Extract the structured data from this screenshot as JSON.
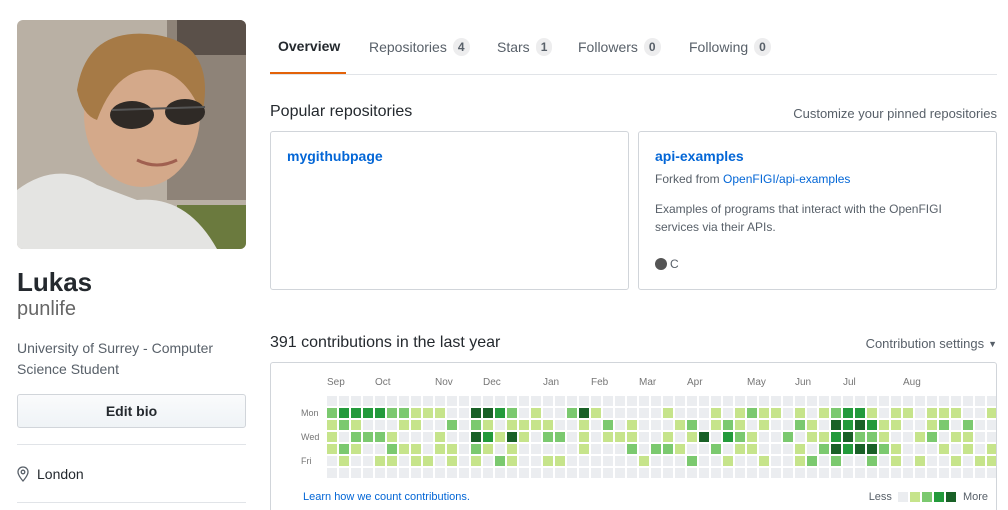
{
  "profile": {
    "name": "Lukas",
    "login": "punlife",
    "bio": "University of Surrey - Computer Science Student",
    "edit_bio_label": "Edit bio",
    "location": "London"
  },
  "tabs": [
    {
      "label": "Overview",
      "count": null
    },
    {
      "label": "Repositories",
      "count": "4"
    },
    {
      "label": "Stars",
      "count": "1"
    },
    {
      "label": "Followers",
      "count": "0"
    },
    {
      "label": "Following",
      "count": "0"
    }
  ],
  "popular": {
    "title": "Popular repositories",
    "customize_label": "Customize your pinned repositories",
    "repos": [
      {
        "name": "mygithubpage"
      },
      {
        "name": "api-examples",
        "fork_prefix": "Forked from",
        "fork_source": "OpenFIGI/api-examples",
        "description": "Examples of programs that interact with the OpenFIGI services via their APIs.",
        "language": "C",
        "language_color": "#555555"
      }
    ]
  },
  "contributions": {
    "title": "391 contributions in the last year",
    "settings_label": "Contribution settings",
    "months": [
      "Sep",
      "Oct",
      "Nov",
      "Dec",
      "Jan",
      "Feb",
      "Mar",
      "Apr",
      "May",
      "Jun",
      "Jul",
      "Aug"
    ],
    "days": [
      "Mon",
      "Wed",
      "Fri"
    ],
    "learn_label": "Learn how we count contributions.",
    "legend_less": "Less",
    "legend_more": "More",
    "colors": [
      "#ebedf0",
      "#c6e48b",
      "#7bc96f",
      "#239a3b",
      "#196127"
    ],
    "weeks": [
      [
        0,
        2,
        1,
        1,
        1,
        0,
        0
      ],
      [
        0,
        3,
        2,
        0,
        2,
        1,
        0
      ],
      [
        0,
        3,
        1,
        2,
        1,
        0,
        0
      ],
      [
        0,
        3,
        0,
        2,
        0,
        0,
        0
      ],
      [
        0,
        3,
        0,
        2,
        0,
        1,
        0
      ],
      [
        0,
        2,
        0,
        1,
        2,
        1,
        0
      ],
      [
        0,
        2,
        1,
        0,
        1,
        0,
        0
      ],
      [
        0,
        1,
        1,
        0,
        1,
        1,
        0
      ],
      [
        0,
        1,
        0,
        0,
        0,
        1,
        0
      ],
      [
        0,
        1,
        0,
        1,
        1,
        0,
        0
      ],
      [
        0,
        0,
        2,
        0,
        1,
        1,
        0
      ],
      [
        0,
        0,
        0,
        0,
        0,
        0,
        0
      ],
      [
        0,
        4,
        2,
        4,
        2,
        1,
        0
      ],
      [
        0,
        4,
        1,
        3,
        1,
        0,
        0
      ],
      [
        0,
        3,
        0,
        1,
        0,
        2,
        0
      ],
      [
        0,
        2,
        1,
        4,
        1,
        1,
        0
      ],
      [
        0,
        0,
        1,
        1,
        0,
        0,
        0
      ],
      [
        0,
        1,
        1,
        0,
        0,
        0,
        0
      ],
      [
        0,
        0,
        1,
        2,
        0,
        1,
        0
      ],
      [
        0,
        0,
        0,
        2,
        0,
        1,
        0
      ],
      [
        0,
        2,
        0,
        0,
        0,
        0,
        0
      ],
      [
        0,
        4,
        1,
        1,
        1,
        0,
        0
      ],
      [
        0,
        1,
        0,
        0,
        0,
        0,
        0
      ],
      [
        0,
        0,
        2,
        1,
        0,
        0,
        0
      ],
      [
        0,
        0,
        0,
        1,
        0,
        0,
        0
      ],
      [
        0,
        0,
        1,
        1,
        2,
        0,
        0
      ],
      [
        0,
        0,
        0,
        0,
        0,
        1,
        0
      ],
      [
        0,
        0,
        0,
        0,
        2,
        0,
        0
      ],
      [
        0,
        1,
        0,
        1,
        2,
        0,
        0
      ],
      [
        0,
        0,
        1,
        0,
        1,
        0,
        0
      ],
      [
        0,
        0,
        2,
        1,
        0,
        2,
        0
      ],
      [
        0,
        0,
        0,
        4,
        0,
        0,
        0
      ],
      [
        0,
        1,
        1,
        0,
        2,
        0,
        0
      ],
      [
        0,
        0,
        2,
        3,
        0,
        1,
        0
      ],
      [
        0,
        1,
        1,
        2,
        1,
        0,
        0
      ],
      [
        0,
        2,
        0,
        1,
        1,
        0,
        0
      ],
      [
        0,
        1,
        1,
        0,
        0,
        1,
        0
      ],
      [
        0,
        1,
        0,
        0,
        0,
        0,
        0
      ],
      [
        0,
        0,
        0,
        2,
        0,
        0,
        0
      ],
      [
        0,
        1,
        2,
        0,
        1,
        1,
        0
      ],
      [
        0,
        0,
        1,
        1,
        0,
        2,
        0
      ],
      [
        0,
        1,
        0,
        1,
        2,
        0,
        0
      ],
      [
        0,
        2,
        4,
        3,
        4,
        2,
        0
      ],
      [
        0,
        3,
        3,
        4,
        3,
        0,
        0
      ],
      [
        0,
        3,
        4,
        2,
        4,
        0,
        0
      ],
      [
        0,
        1,
        3,
        2,
        4,
        2,
        0
      ],
      [
        0,
        0,
        1,
        1,
        2,
        0,
        0
      ],
      [
        0,
        1,
        1,
        0,
        1,
        1,
        0
      ],
      [
        0,
        1,
        0,
        0,
        0,
        0,
        0
      ],
      [
        0,
        0,
        0,
        1,
        0,
        1,
        0
      ],
      [
        0,
        1,
        1,
        2,
        0,
        0,
        0
      ],
      [
        0,
        1,
        2,
        0,
        1,
        0,
        0
      ],
      [
        0,
        1,
        0,
        1,
        0,
        1,
        0
      ],
      [
        0,
        0,
        2,
        1,
        1,
        0,
        0
      ],
      [
        0,
        0,
        0,
        0,
        0,
        1,
        0
      ],
      [
        0,
        1,
        0,
        0,
        1,
        1,
        0
      ],
      [
        0,
        0,
        0,
        1,
        0,
        0,
        0
      ]
    ]
  }
}
